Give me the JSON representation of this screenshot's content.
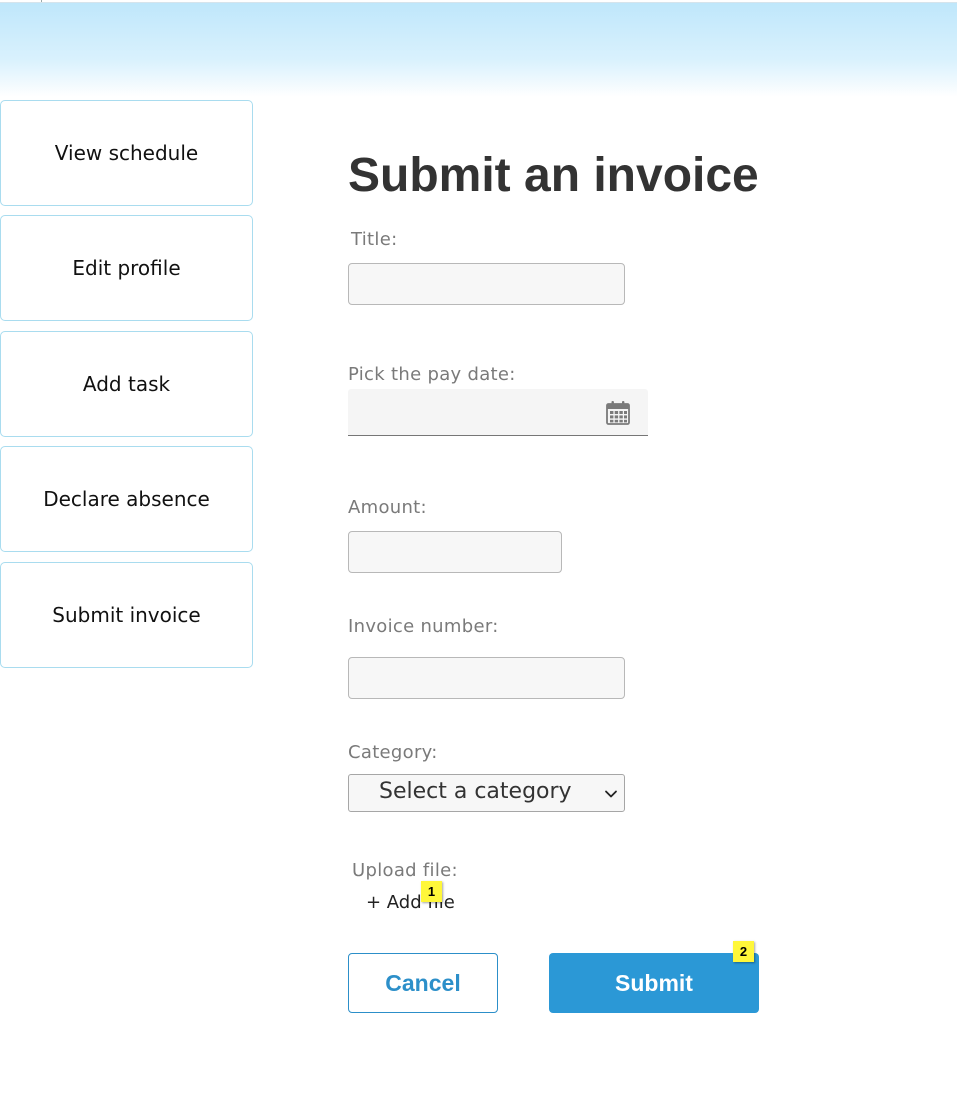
{
  "sidebar": {
    "items": [
      {
        "label": "View schedule"
      },
      {
        "label": "Edit profile"
      },
      {
        "label": "Add task"
      },
      {
        "label": "Declare absence"
      },
      {
        "label": "Submit invoice"
      }
    ]
  },
  "form": {
    "title": "Submit an invoice",
    "title_field": {
      "label": "Title:",
      "value": ""
    },
    "pay_date": {
      "label": "Pick the pay date:",
      "value": "",
      "icon": "calendar-icon"
    },
    "amount": {
      "label": "Amount:",
      "value": ""
    },
    "invoice_number": {
      "label": "Invoice number:",
      "value": ""
    },
    "category": {
      "label": "Category:",
      "selected": "Select a category",
      "icon": "chevron-down-icon"
    },
    "upload": {
      "label": "Upload file:",
      "add_file": "+ Add file"
    },
    "cancel_label": "Cancel",
    "submit_label": "Submit"
  },
  "markers": [
    {
      "label": "1"
    },
    {
      "label": "2"
    }
  ],
  "colors": {
    "accent": "#2b98d6",
    "sidebar_border": "#a9dcef",
    "banner": "#bfe7fb",
    "marker": "#fff73a",
    "title": "#333333",
    "label": "#7a7a7a"
  }
}
